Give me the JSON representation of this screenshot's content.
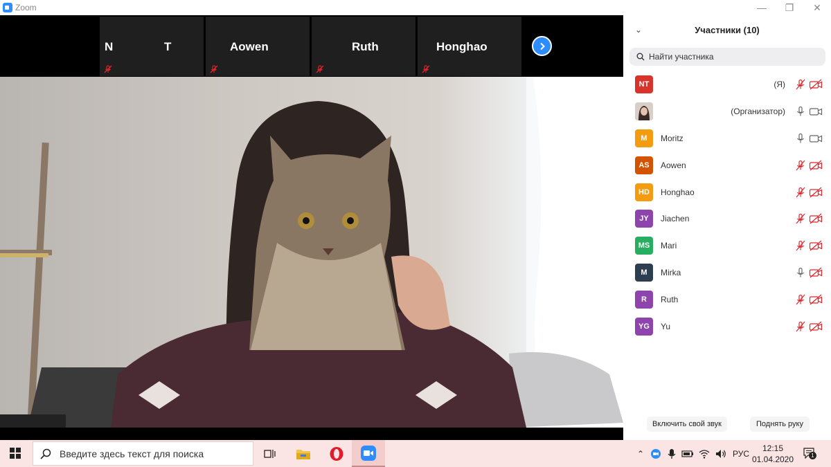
{
  "window": {
    "title": "Zoom"
  },
  "thumbnails": [
    {
      "name": "N",
      "name2": "T"
    },
    {
      "name": "Aowen"
    },
    {
      "name": "Ruth"
    },
    {
      "name": "Honghao"
    }
  ],
  "panel": {
    "title": "Участники (10)",
    "search_placeholder": "Найти участника",
    "participants": [
      {
        "initials": "NT",
        "name": "",
        "suffix": "(Я)",
        "color": "#d9342b",
        "mic": "muted",
        "video": "off"
      },
      {
        "initials": "",
        "name": "",
        "suffix": "(Организатор)",
        "color": "#7a6a60",
        "mic": "on",
        "video": "on",
        "photo": true
      },
      {
        "initials": "M",
        "name": "Moritz",
        "suffix": "",
        "color": "#f39c12",
        "mic": "on",
        "video": "on"
      },
      {
        "initials": "AS",
        "name": "Aowen",
        "suffix": "",
        "color": "#d35400",
        "mic": "muted",
        "video": "off"
      },
      {
        "initials": "HD",
        "name": "Honghao",
        "suffix": "",
        "color": "#f39c12",
        "mic": "muted",
        "video": "off"
      },
      {
        "initials": "JY",
        "name": "Jiachen",
        "suffix": "",
        "color": "#8e44ad",
        "mic": "muted",
        "video": "off"
      },
      {
        "initials": "MS",
        "name": "Mari",
        "suffix": "",
        "color": "#27ae60",
        "mic": "muted",
        "video": "off"
      },
      {
        "initials": "M",
        "name": "Mirka",
        "suffix": "",
        "color": "#2c3e50",
        "mic": "on",
        "video": "off"
      },
      {
        "initials": "R",
        "name": "Ruth",
        "suffix": "",
        "color": "#8e44ad",
        "mic": "muted",
        "video": "off"
      },
      {
        "initials": "YG",
        "name": "Yu",
        "suffix": "",
        "color": "#8e44ad",
        "mic": "muted",
        "video": "off"
      }
    ],
    "unmute_label": "Включить свой звук",
    "raise_hand_label": "Поднять руку"
  },
  "taskbar": {
    "search_text": "Введите здесь текст для поиска",
    "lang": "РУС",
    "time": "12:15",
    "date": "01.04.2020",
    "notifications": "1"
  },
  "colors": {
    "accent": "#2d8cff",
    "muted_red": "#e0242a"
  }
}
